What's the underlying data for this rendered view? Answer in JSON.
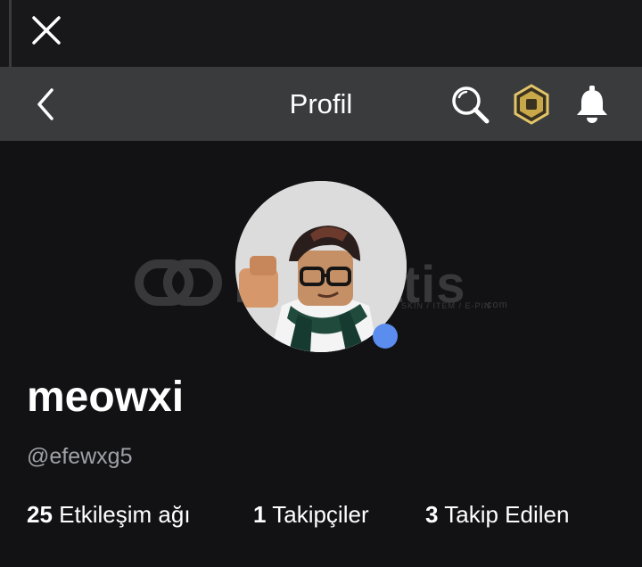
{
  "header": {
    "title": "Profil",
    "icons": [
      "close-icon",
      "back-icon",
      "search-icon",
      "robux-icon",
      "bell-icon"
    ]
  },
  "watermark": {
    "text": "itemsatis",
    "subtext": "SKIN / ITEM / E-PIN",
    "domain": ".com"
  },
  "profile": {
    "display_name": "meowxi",
    "username": "@efewxg5",
    "presence_color": "#5b8def"
  },
  "stats": {
    "friends_count": "25",
    "friends_label": "Etkileşim ağı",
    "followers_count": "1",
    "followers_label": "Takipçiler",
    "following_count": "3",
    "following_label": "Takip Edilen"
  },
  "colors": {
    "background": "#121215",
    "header": "#393b3d",
    "robux_gold": "#c9a84a",
    "muted_text": "#9fa1a6"
  }
}
